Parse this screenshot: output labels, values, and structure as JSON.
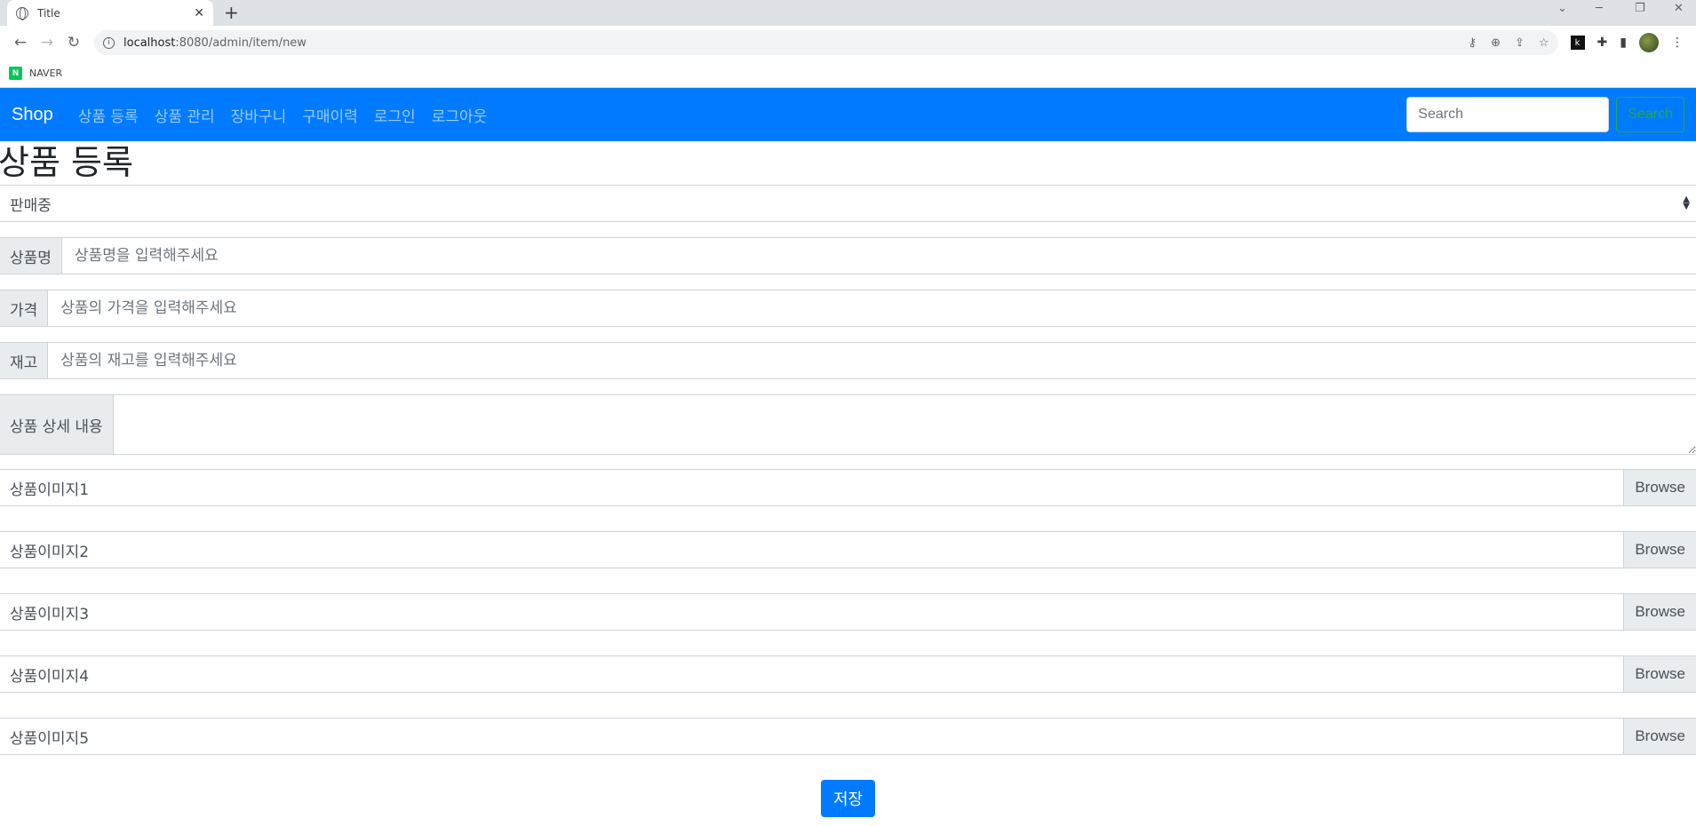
{
  "browser": {
    "tab_title": "Title",
    "url_host": "localhost",
    "url_path": ":8080/admin/item/new",
    "bookmark": "NAVER",
    "bookmark_logo": "N"
  },
  "navbar": {
    "brand": "Shop",
    "links": [
      "상품 등록",
      "상품 관리",
      "장바구니",
      "구매이력",
      "로그인",
      "로그아웃"
    ],
    "search_placeholder": "Search",
    "search_button": "Search"
  },
  "form": {
    "title": "상품 등록",
    "status_select": "판매중",
    "name_label": "상품명",
    "name_placeholder": "상품명을 입력해주세요",
    "price_label": "가격",
    "price_placeholder": "상품의 가격을 입력해주세요",
    "stock_label": "재고",
    "stock_placeholder": "상품의 재고를 입력해주세요",
    "detail_label": "상품 상세 내용",
    "images": [
      "상품이미지1",
      "상품이미지2",
      "상품이미지3",
      "상품이미지4",
      "상품이미지5"
    ],
    "browse_label": "Browse",
    "save_button": "저장"
  },
  "colors": {
    "navbar": "#007bff",
    "search_button": "#28a745",
    "save_button": "#007bff"
  }
}
